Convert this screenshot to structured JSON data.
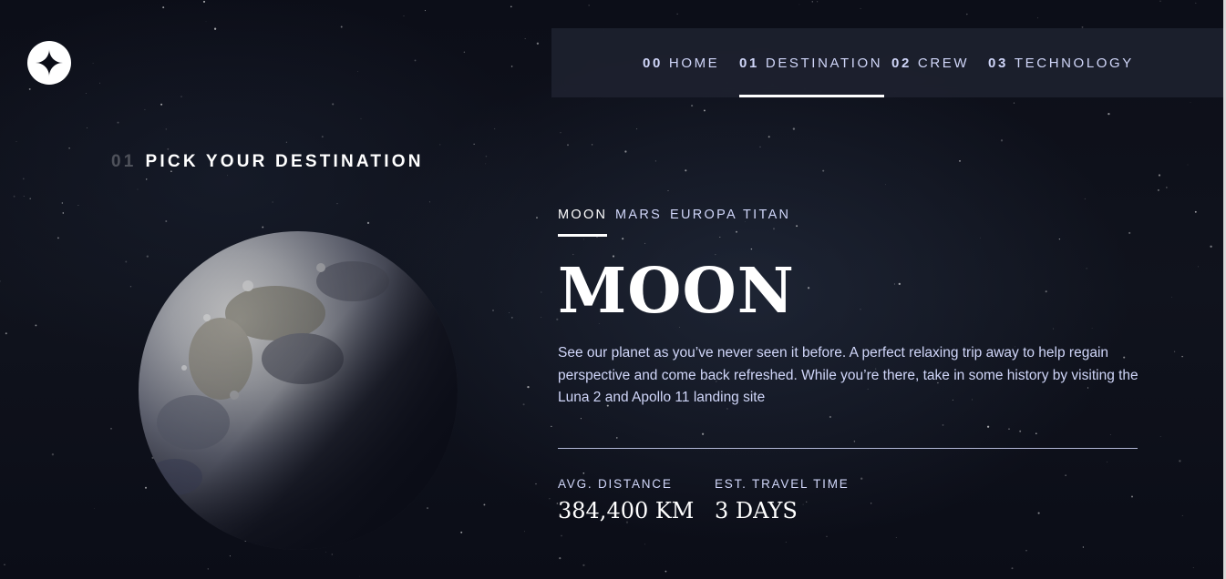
{
  "logo": {
    "icon": "star-icon"
  },
  "nav": {
    "items": [
      {
        "num": "00",
        "label": "HOME",
        "active": false
      },
      {
        "num": "01",
        "label": "DESTINATION",
        "active": true
      },
      {
        "num": "02",
        "label": "CREW",
        "active": false
      },
      {
        "num": "03",
        "label": "TECHNOLOGY",
        "active": false
      }
    ]
  },
  "heading": {
    "num": "01",
    "text": "PICK YOUR DESTINATION"
  },
  "planet": {
    "icon": "moon-image"
  },
  "tabs": [
    {
      "label": "MOON",
      "active": true
    },
    {
      "label": "MARS",
      "active": false
    },
    {
      "label": "EUROPA",
      "active": false
    },
    {
      "label": "TITAN",
      "active": false
    }
  ],
  "destination": {
    "name": "MOON",
    "description": "See our planet as you’ve never seen it before. A perfect relaxing trip away to help regain perspective and come back refreshed. While you’re there, take in some history by visiting the Luna 2 and Apollo 11 landing site"
  },
  "stats": {
    "distance": {
      "label": "AVG. DISTANCE",
      "value": "384,400 KM"
    },
    "travel": {
      "label": "EST. TRAVEL TIME",
      "value": "3 DAYS"
    }
  },
  "colors": {
    "background": "#0b0d17",
    "text_light": "#d0d6f9",
    "white": "#ffffff"
  }
}
